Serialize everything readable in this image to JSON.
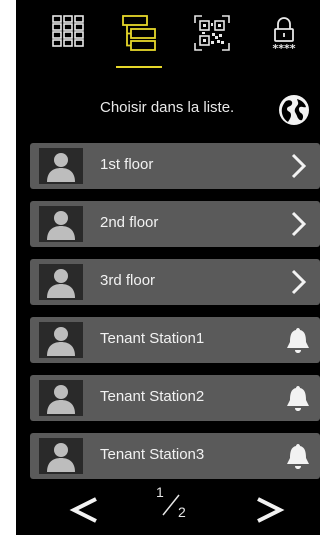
{
  "colors": {
    "accent": "#e6d72a",
    "background": "#000000",
    "row": "#5a5a5a",
    "text": "#f2f2f2"
  },
  "nav": {
    "tabs": [
      {
        "icon": "keypad-grid-icon",
        "active": false
      },
      {
        "icon": "directory-list-icon",
        "active": true
      },
      {
        "icon": "qr-code-icon",
        "active": false
      },
      {
        "icon": "lock-code-icon",
        "active": false
      }
    ]
  },
  "prompt": {
    "text": "Choisir dans la liste.",
    "icon": "globe-icon"
  },
  "list": {
    "rows": [
      {
        "label": "1st floor",
        "icon": "avatar-icon",
        "action": "chevron-right-icon"
      },
      {
        "label": "2nd floor",
        "icon": "avatar-icon",
        "action": "chevron-right-icon"
      },
      {
        "label": "3rd floor",
        "icon": "avatar-icon",
        "action": "chevron-right-icon"
      },
      {
        "label": "Tenant Station1",
        "icon": "avatar-icon",
        "action": "bell-icon"
      },
      {
        "label": "Tenant Station2",
        "icon": "avatar-icon",
        "action": "bell-icon"
      },
      {
        "label": "Tenant Station3",
        "icon": "avatar-icon",
        "action": "bell-icon"
      }
    ]
  },
  "pager": {
    "current": "1",
    "total": "2"
  }
}
